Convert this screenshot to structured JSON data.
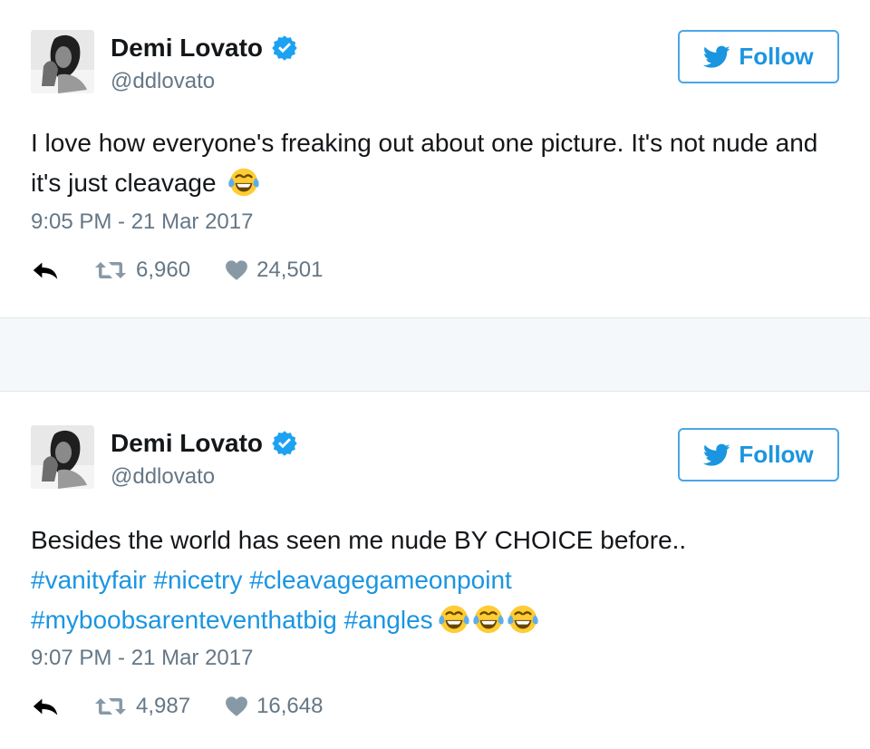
{
  "colors": {
    "link": "#1b95e0",
    "follow_border": "#4aa6e6",
    "verified": "#1da1f2",
    "muted_text": "#657786",
    "separator": "#f5f8fa"
  },
  "tweets": [
    {
      "author": {
        "name": "Demi Lovato",
        "handle": "@ddlovato",
        "verified": true,
        "verified_icon": "verified-badge-icon"
      },
      "follow_label": "Follow",
      "text": "I love how everyone's freaking out about one picture. It's not nude and it's just cleavage",
      "emoji": [
        "face-with-tears-of-joy"
      ],
      "timestamp": "9:05 PM - 21 Mar 2017",
      "retweets": "6,960",
      "likes": "24,501"
    },
    {
      "author": {
        "name": "Demi Lovato",
        "handle": "@ddlovato",
        "verified": true,
        "verified_icon": "verified-badge-icon"
      },
      "follow_label": "Follow",
      "text": "Besides the world has seen me nude BY CHOICE before..",
      "hashtags": [
        "#vanityfair",
        "#nicetry",
        "#cleavagegameonpoint",
        "#myboobsarenteventhatbig",
        "#angles"
      ],
      "emoji": [
        "face-with-tears-of-joy",
        "face-with-tears-of-joy",
        "face-with-tears-of-joy"
      ],
      "timestamp": "9:07 PM - 21 Mar 2017",
      "retweets": "4,987",
      "likes": "16,648"
    }
  ]
}
